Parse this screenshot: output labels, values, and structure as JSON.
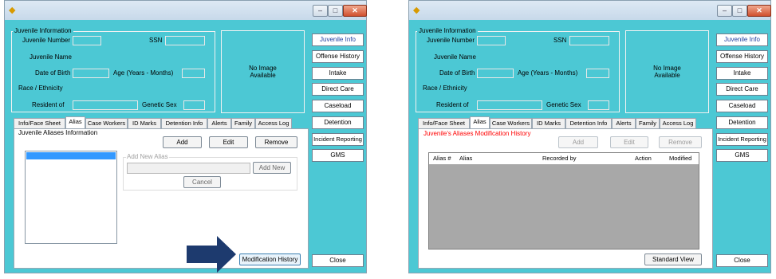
{
  "left": {
    "section_title": "Juvenile Information",
    "fields": {
      "juvenile_number": "Juvenile Number",
      "ssn": "SSN",
      "juvenile_name": "Juvenile Name",
      "date_of_birth": "Date of Birth",
      "age": "Age (Years - Months)",
      "race_ethnicity": "Race / Ethnicity",
      "resident_of": "Resident of",
      "genetic_sex": "Genetic Sex"
    },
    "image_text": "No Image\nAvailable",
    "nav": [
      "Juvenile Info",
      "Offense History",
      "Intake",
      "Direct Care",
      "Caseload",
      "Detention",
      "Incident Reporting",
      "GMS"
    ],
    "close": "Close",
    "tabs": [
      "Info/Face Sheet",
      "Alias",
      "Case Workers",
      "ID Marks",
      "Detention Info",
      "Alerts",
      "Family",
      "Access Log"
    ],
    "panel_title": "Juvenile Aliases Information",
    "add": "Add",
    "edit": "Edit",
    "remove": "Remove",
    "add_new_alias_group": "Add New Alias",
    "add_new_button": "Add New",
    "cancel": "Cancel",
    "modification_history": "Modification History"
  },
  "right": {
    "section_title": "Juvenile Information",
    "fields": {
      "juvenile_number": "Juvenile Number",
      "ssn": "SSN",
      "juvenile_name": "Juvenile Name",
      "date_of_birth": "Date of Birth",
      "age": "Age (Years - Months)",
      "race_ethnicity": "Race / Ethnicity",
      "resident_of": "Resident of",
      "genetic_sex": "Genetic Sex"
    },
    "image_text": "No Image\nAvailable",
    "nav": [
      "Juvenile Info",
      "Offense History",
      "Intake",
      "Direct Care",
      "Caseload",
      "Detention",
      "Incident Reporting",
      "GMS"
    ],
    "close": "Close",
    "tabs": [
      "Info/Face Sheet",
      "Alias",
      "Case Workers",
      "ID Marks",
      "Detention Info",
      "Alerts",
      "Family",
      "Access Log"
    ],
    "panel_title": "Juvenile's Aliases Modification History",
    "add": "Add",
    "edit": "Edit",
    "remove": "Remove",
    "grid_headers": [
      "Alias #",
      "Alias",
      "Recorded by",
      "Action",
      "Modified"
    ],
    "standard_view": "Standard View"
  },
  "colors": {
    "window_bg": "#4cc8d4",
    "nav_highlight_text": "#1f3ea0",
    "red_title": "#ff0000",
    "arrow": "#1d3a6e",
    "selection": "#3399ff"
  },
  "icons": {
    "app": "app-icon",
    "minimize": "minimize-icon",
    "maximize": "maximize-icon",
    "close": "close-icon",
    "arrow": "right-arrow-icon"
  }
}
